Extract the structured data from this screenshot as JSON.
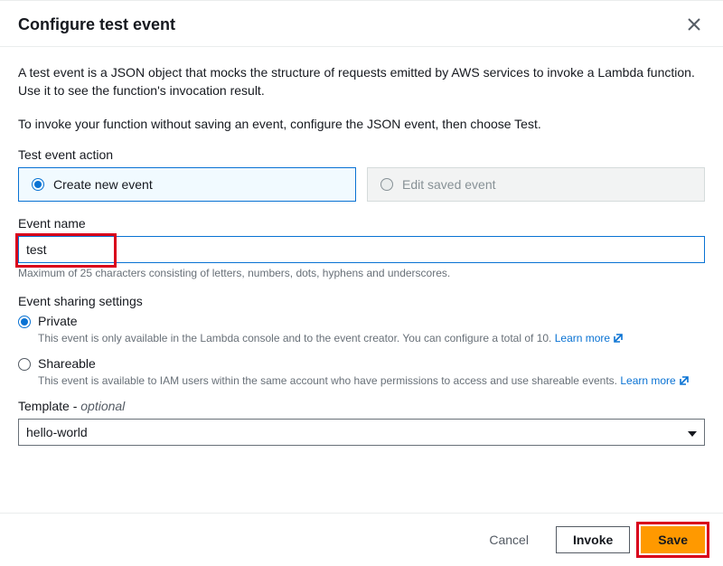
{
  "header": {
    "title": "Configure test event"
  },
  "intro": {
    "p1": "A test event is a JSON object that mocks the structure of requests emitted by AWS services to invoke a Lambda function. Use it to see the function's invocation result.",
    "p2": "To invoke your function without saving an event, configure the JSON event, then choose Test."
  },
  "action": {
    "label": "Test event action",
    "create": "Create new event",
    "edit": "Edit saved event"
  },
  "eventName": {
    "label": "Event name",
    "value": "test",
    "helper": "Maximum of 25 characters consisting of letters, numbers, dots, hyphens and underscores."
  },
  "sharing": {
    "label": "Event sharing settings",
    "privateLabel": "Private",
    "privateDesc": "This event is only available in the Lambda console and to the event creator. You can configure a total of 10. ",
    "shareableLabel": "Shareable",
    "shareableDesc": "This event is available to IAM users within the same account who have permissions to access and use shareable events. ",
    "learnMore": "Learn more"
  },
  "template": {
    "label": "Template - ",
    "optional": "optional",
    "value": "hello-world"
  },
  "footer": {
    "cancel": "Cancel",
    "invoke": "Invoke",
    "save": "Save"
  }
}
